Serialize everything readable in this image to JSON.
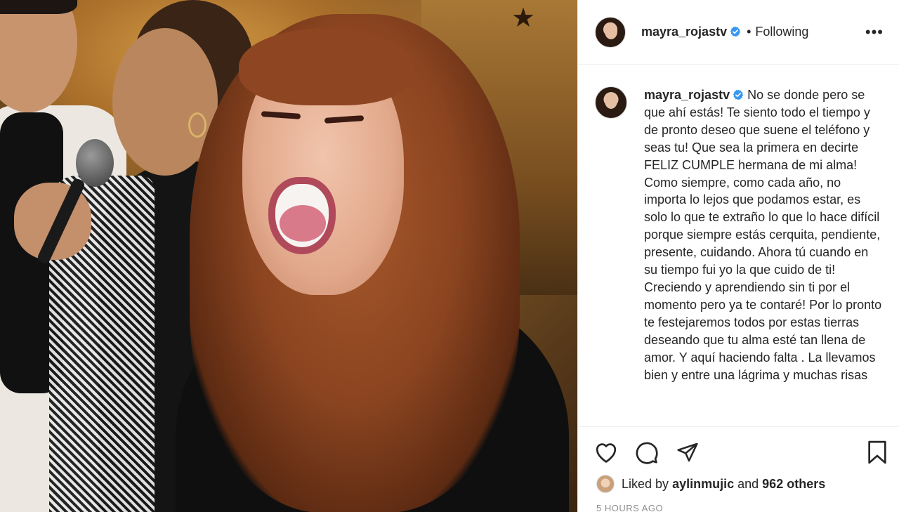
{
  "post": {
    "username": "mayra_rojastv",
    "follow_status": "Following",
    "more_label": "•••",
    "separator": "•",
    "caption": "No se donde pero se que ahí estás! Te siento todo el tiempo y de pronto deseo que suene el teléfono y seas tu! Que sea la primera en decirte FELIZ CUMPLE hermana de mi alma! Como siempre, como cada año, no importa lo lejos que podamos estar, es solo lo que te extraño lo que lo hace difícil porque siempre estás cerquita, pendiente, presente, cuidando. Ahora tú cuando en su tiempo fui yo la que cuido de ti! Creciendo y aprendiendo sin ti por el momento pero ya te contaré! Por lo pronto te festejaremos todos por estas tierras deseando que tu alma esté tan llena de amor. Y aquí haciendo falta . La llevamos bien y entre una lágrima y muchas risas",
    "likes": {
      "prefix": "Liked by",
      "user": "aylinmujic",
      "connector": "and",
      "others": "962 others"
    },
    "timestamp": "5 HOURS AGO"
  },
  "icons": {
    "like": "heart-icon",
    "comment": "comment-icon",
    "share": "share-icon",
    "save": "bookmark-icon",
    "verified": "verified-badge-icon",
    "more": "more-options-icon"
  },
  "colors": {
    "text": "#262626",
    "muted": "#8e8e8e",
    "verified": "#3897f0",
    "border": "#efefef"
  }
}
